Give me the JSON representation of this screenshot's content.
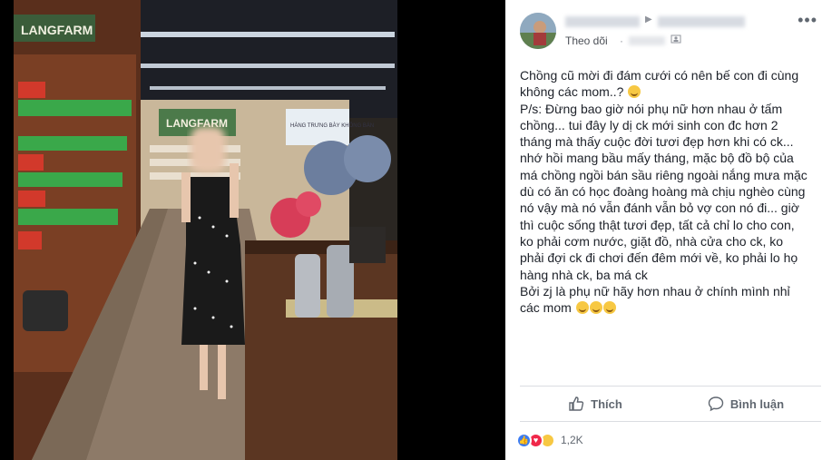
{
  "header": {
    "follow_label": "Theo dõi",
    "separator": "·"
  },
  "post": {
    "paragraphs": [
      "Chồng cũ mời đi đám cưới có nên bế con đi cùng không các mom..?",
      "P/s: Đừng bao giờ nói phụ nữ hơn nhau ở tấm chồng... tui đây ly dị ck mới sinh con đc hơn 2 tháng mà thấy cuộc đời tươi đẹp hơn khi có ck... nhớ hồi mang bầu mấy tháng, mặc bộ đồ bộ của má chồng ngồi bán sầu riêng ngoài nắng mưa mặc dù có ăn có học đoàng hoàng mà chịu nghèo cùng nó vậy mà nó vẫn đánh vẫn bỏ vợ con nó đi... giờ thì cuộc sống thật tươi đẹp, tất cả chỉ lo cho con, ko phải cơm nước, giặt đồ, nhà cửa cho ck, ko phải đợi ck đi chơi đến đêm mới về, ko phải lo họ hàng nhà ck, ba má ck",
      "Bởi zj là phụ nữ hãy hơn nhau ở chính mình nhỉ các mom"
    ]
  },
  "photo": {
    "store_sign": "LANGFARM",
    "store_sign2": "LANGFARM",
    "banner_text": "HÀNG TRƯNG BÀY KHÔNG BÁN"
  },
  "actions": {
    "like_label": "Thích",
    "comment_label": "Bình luận"
  },
  "reactions": {
    "count": "1,2K",
    "types": [
      "like",
      "love",
      "haha"
    ]
  },
  "colors": {
    "text": "#1d2129",
    "secondary": "#606770",
    "like_blue": "#3b7cf4",
    "love_red": "#f0284a",
    "haha_yellow": "#f7c843"
  }
}
